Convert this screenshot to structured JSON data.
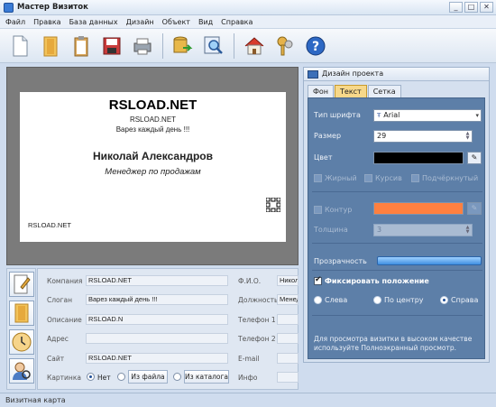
{
  "app": {
    "title": "Мастер Визиток",
    "status": "Визитная карта"
  },
  "menu": [
    "Файл",
    "Правка",
    "База данных",
    "Дизайн",
    "Объект",
    "Вид",
    "Справка"
  ],
  "toolbar": [
    "new-doc-icon",
    "open-folder-icon",
    "clipboard-icon",
    "save-disk-icon",
    "print-icon",
    "database-export-icon",
    "print-preview-icon",
    "home-icon",
    "keys-icon",
    "help-icon"
  ],
  "card": {
    "company": "RSLOAD.NET",
    "company_small": "RSLOAD.NET",
    "slogan": "Варез каждый день !!!",
    "name": "Николай Александров",
    "position": "Менеджер по продажам",
    "site": "RSLOAD.NET"
  },
  "form": {
    "labels": {
      "company": "Компания",
      "slogan": "Слоган",
      "description": "Описание",
      "address": "Адрес",
      "site": "Сайт",
      "picture": "Картинка",
      "fio": "Ф.И.О.",
      "post": "Должность",
      "phone1": "Телефон 1",
      "phone2": "Телефон 2",
      "email": "E-mail",
      "info": "Инфо"
    },
    "values": {
      "company": "RSLOAD.NET",
      "slogan": "Варез каждый день !!!",
      "description": "RSLOAD.N",
      "address": "",
      "site": "RSLOAD.NET",
      "fio": "Никола",
      "post": "Менедж",
      "phone1": "",
      "phone2": "",
      "email": "",
      "info": ""
    },
    "picture_options": {
      "none": "Нет",
      "from_file": "Из файла",
      "from_catalog": "Из каталога"
    }
  },
  "panel": {
    "title": "Дизайн проекта",
    "tabs": [
      "Фон",
      "Текст",
      "Сетка"
    ],
    "font_type_label": "Тип шрифта",
    "font_value": "Arial",
    "size_label": "Размер",
    "size_value": "29",
    "color_label": "Цвет",
    "bold": "Жирный",
    "italic": "Курсив",
    "underline": "Подчёркнутый",
    "outline": "Контур",
    "thickness_label": "Толщина",
    "thickness_value": "3",
    "transparency_label": "Прозрачность",
    "fix_position": "Фиксировать положение",
    "align_left": "Слева",
    "align_center": "По центру",
    "align_right": "Справа",
    "hint": "Для просмотра визитки в высоком качестве используйте Полноэкранный просмотр."
  },
  "colors": {
    "text_color": "#000000",
    "outline_color": "#ff8040",
    "active_tab": "#f7d88a",
    "transparency_bar": "#5fa8f0"
  }
}
